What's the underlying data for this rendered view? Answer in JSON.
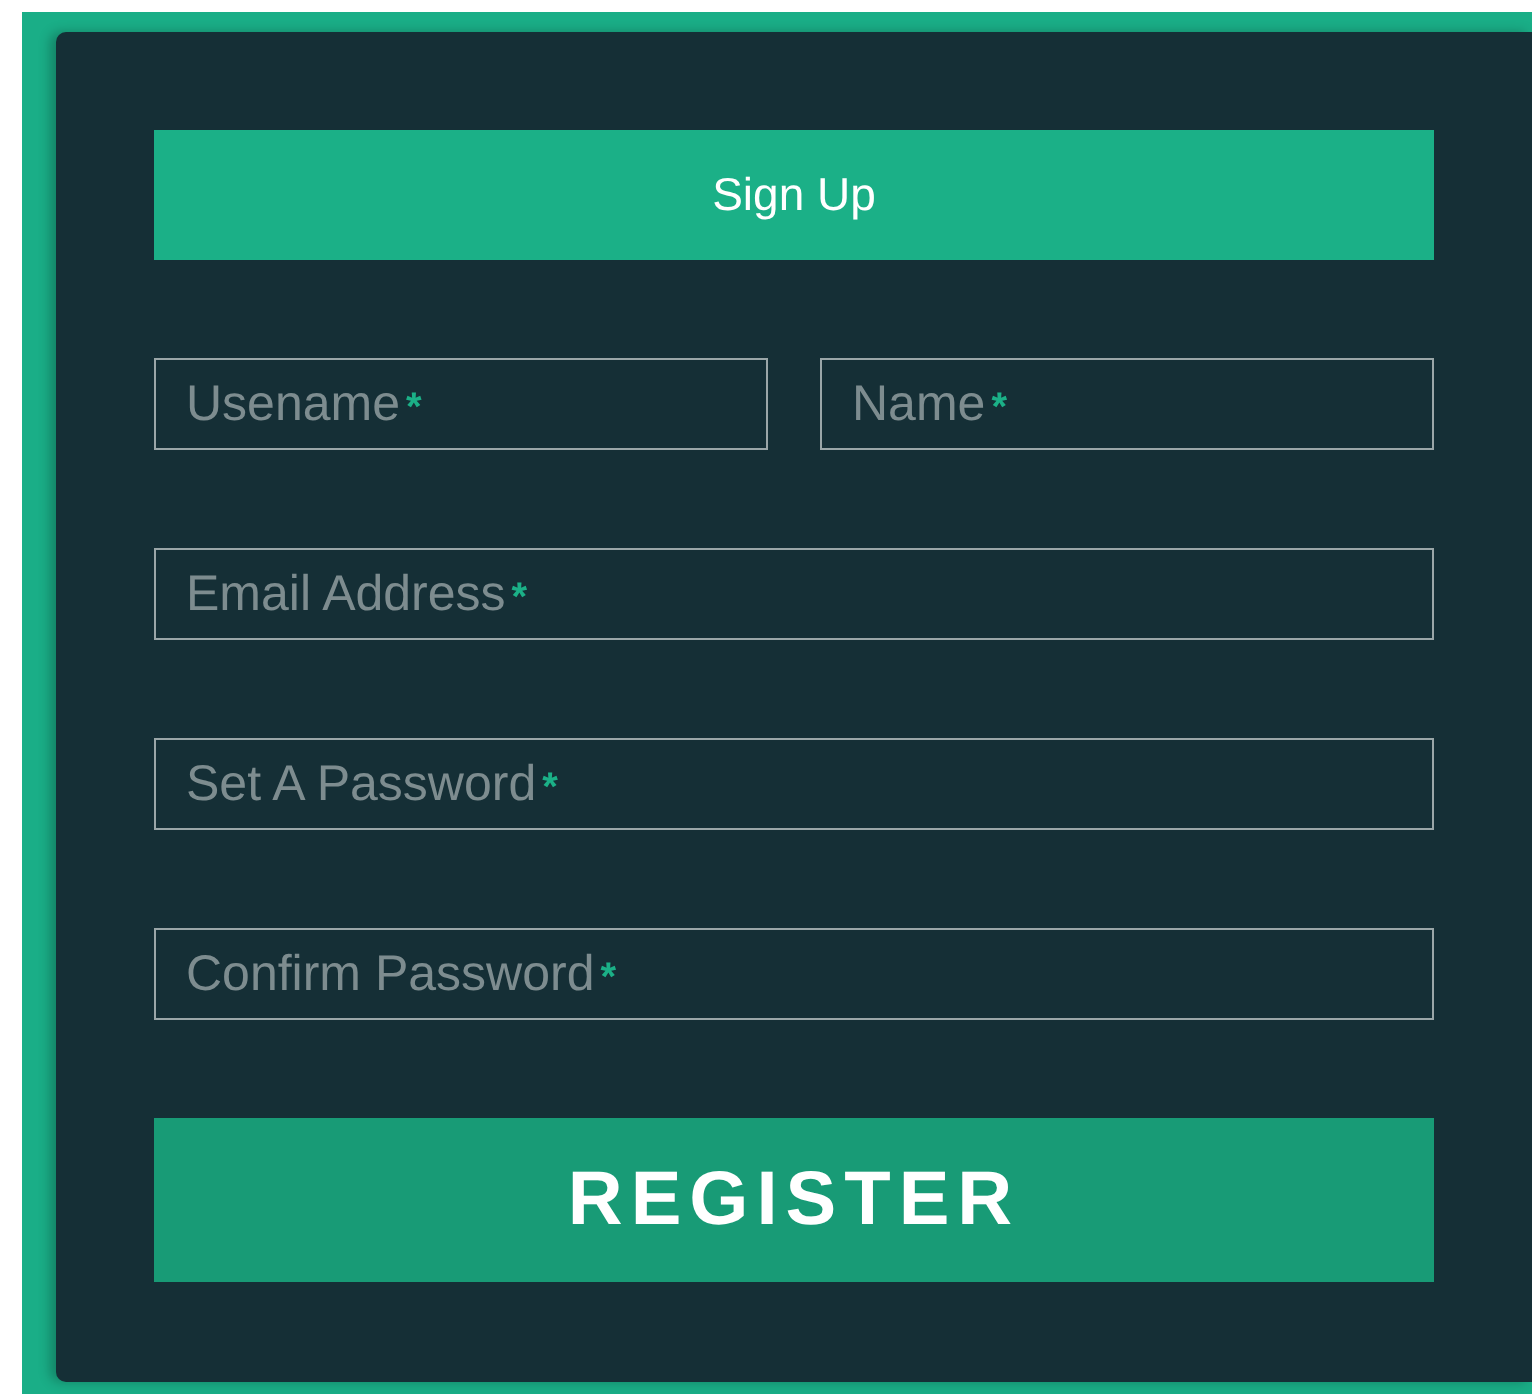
{
  "header": {
    "title": "Sign Up"
  },
  "field_rows": [
    {
      "fields": [
        {
          "label": "Usename",
          "required": true
        },
        {
          "label": "Name",
          "required": true
        }
      ]
    },
    {
      "fields": [
        {
          "label": "Email Address",
          "required": true
        }
      ]
    },
    {
      "fields": [
        {
          "label": "Set A Password",
          "required": true
        }
      ]
    },
    {
      "fields": [
        {
          "label": "Confirm Password",
          "required": true
        }
      ]
    }
  ],
  "required_mark": "*",
  "submit_button": {
    "label": "REGISTER"
  }
}
